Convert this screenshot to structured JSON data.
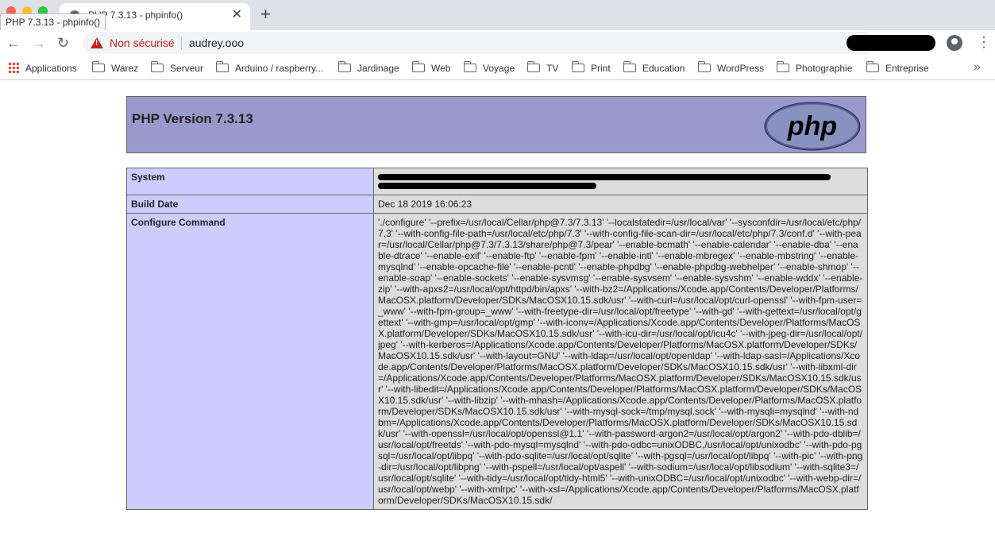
{
  "browser": {
    "tab_title": "PHP 7.3.13 - phpinfo()",
    "tooltip": "PHP 7.3.13 - phpinfo()",
    "security_label": "Non sécurisé",
    "url": "audrey.ooo",
    "bookmarks": [
      "Applications",
      "Warez",
      "Serveur",
      "Arduino / raspberry...",
      "Jardinage",
      "Web",
      "Voyage",
      "TV",
      "Print",
      "Education",
      "WordPress",
      "Photographie",
      "Entreprise"
    ]
  },
  "phpinfo": {
    "title": "PHP Version 7.3.13",
    "logo_text": "php",
    "rows": {
      "system_label": "System",
      "build_date_label": "Build Date",
      "build_date_value": "Dec 18 2019 16:06:23",
      "configure_label": "Configure Command",
      "configure_value": "'./configure' '--prefix=/usr/local/Cellar/php@7.3/7.3.13' '--localstatedir=/usr/local/var' '--sysconfdir=/usr/local/etc/php/7.3' '--with-config-file-path=/usr/local/etc/php/7.3' '--with-config-file-scan-dir=/usr/local/etc/php/7.3/conf.d' '--with-pear=/usr/local/Cellar/php@7.3/7.3.13/share/php@7.3/pear' '--enable-bcmath' '--enable-calendar' '--enable-dba' '--enable-dtrace' '--enable-exif' '--enable-ftp' '--enable-fpm' '--enable-intl' '--enable-mbregex' '--enable-mbstring' '--enable-mysqlnd' '--enable-opcache-file' '--enable-pcntl' '--enable-phpdbg' '--enable-phpdbg-webhelper' '--enable-shmop' '--enable-soap' '--enable-sockets' '--enable-sysvmsg' '--enable-sysvsem' '--enable-sysvshm' '--enable-wddx' '--enable-zip' '--with-apxs2=/usr/local/opt/httpd/bin/apxs' '--with-bz2=/Applications/Xcode.app/Contents/Developer/Platforms/MacOSX.platform/Developer/SDKs/MacOSX10.15.sdk/usr' '--with-curl=/usr/local/opt/curl-openssl' '--with-fpm-user=_www' '--with-fpm-group=_www' '--with-freetype-dir=/usr/local/opt/freetype' '--with-gd' '--with-gettext=/usr/local/opt/gettext' '--with-gmp=/usr/local/opt/gmp' '--with-iconv=/Applications/Xcode.app/Contents/Developer/Platforms/MacOSX.platform/Developer/SDKs/MacOSX10.15.sdk/usr' '--with-icu-dir=/usr/local/opt/icu4c' '--with-jpeg-dir=/usr/local/opt/jpeg' '--with-kerberos=/Applications/Xcode.app/Contents/Developer/Platforms/MacOSX.platform/Developer/SDKs/MacOSX10.15.sdk/usr' '--with-layout=GNU' '--with-ldap=/usr/local/opt/openldap' '--with-ldap-sasl=/Applications/Xcode.app/Contents/Developer/Platforms/MacOSX.platform/Developer/SDKs/MacOSX10.15.sdk/usr' '--with-libxml-dir=/Applications/Xcode.app/Contents/Developer/Platforms/MacOSX.platform/Developer/SDKs/MacOSX10.15.sdk/usr' '--with-libedit=/Applications/Xcode.app/Contents/Developer/Platforms/MacOSX.platform/Developer/SDKs/MacOSX10.15.sdk/usr' '--with-libzip' '--with-mhash=/Applications/Xcode.app/Contents/Developer/Platforms/MacOSX.platform/Developer/SDKs/MacOSX10.15.sdk/usr' '--with-mysql-sock=/tmp/mysql.sock' '--with-mysqli=mysqlnd' '--with-ndbm=/Applications/Xcode.app/Contents/Developer/Platforms/MacOSX.platform/Developer/SDKs/MacOSX10.15.sdk/usr' '--with-openssl=/usr/local/opt/openssl@1.1' '--with-password-argon2=/usr/local/opt/argon2' '--with-pdo-dblib=/usr/local/opt/freetds' '--with-pdo-mysql=mysqlnd' '--with-pdo-odbc=unixODBC,/usr/local/opt/unixodbc' '--with-pdo-pgsql=/usr/local/opt/libpq' '--with-pdo-sqlite=/usr/local/opt/sqlite' '--with-pgsql=/usr/local/opt/libpq' '--with-pic' '--with-png-dir=/usr/local/opt/libpng' '--with-pspell=/usr/local/opt/aspell' '--with-sodium=/usr/local/opt/libsodium' '--with-sqlite3=/usr/local/opt/sqlite' '--with-tidy=/usr/local/opt/tidy-html5' '--with-unixODBC=/usr/local/opt/unixodbc' '--with-webp-dir=/usr/local/opt/webp' '--with-xmlrpc' '--with-xsl=/Applications/Xcode.app/Contents/Developer/Platforms/MacOSX.platform/Developer/SDKs/MacOSX10.15.sdk/"
    }
  },
  "colors": {
    "header_bg": "#9999cc",
    "label_bg": "#ccccff",
    "value_bg": "#dddddd",
    "warning_red": "#c5221f"
  },
  "icons": [
    "close-icon",
    "plus-icon",
    "back-arrow-icon",
    "forward-arrow-icon",
    "reload-icon",
    "warning-icon",
    "translate-icon",
    "star-icon",
    "profile-icon",
    "menu-icon",
    "apps-grid-icon",
    "folder-icon",
    "chevron-right-icon",
    "php-logo"
  ]
}
